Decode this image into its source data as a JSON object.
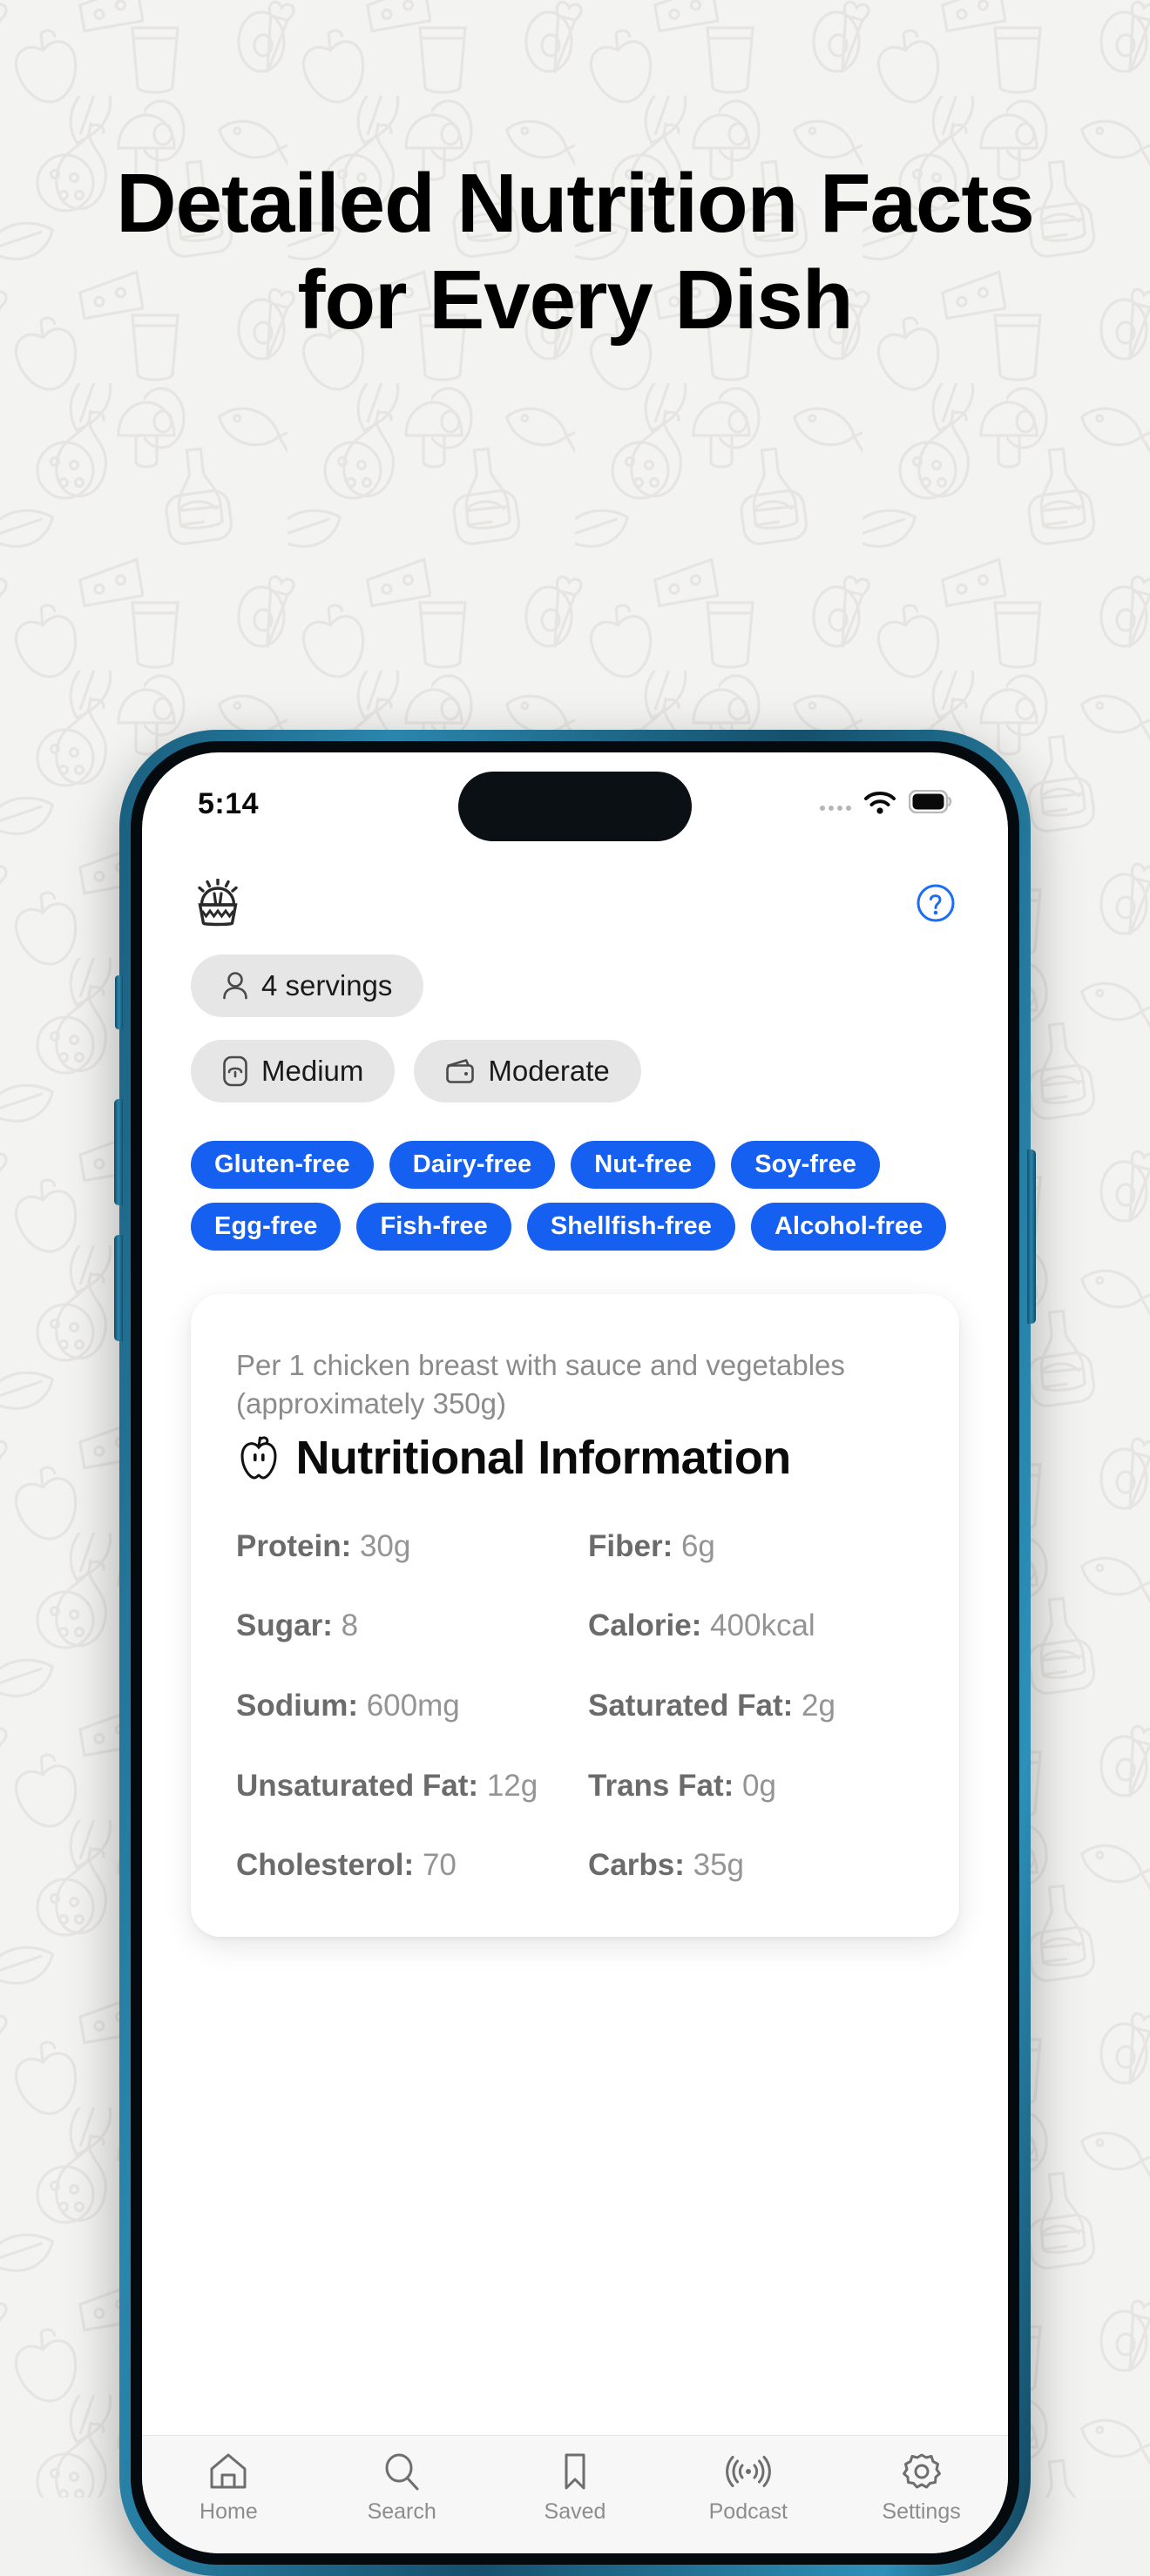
{
  "headline": "Detailed Nutrition Facts for Every Dish",
  "theme": {
    "accent_blue": "#1560f0",
    "help_blue": "#1a6ef5",
    "phone_frame": "#1a6387",
    "chip_bg": "#e6e6e6",
    "page_bg": "#f3f3f1"
  },
  "status_bar": {
    "time": "5:14",
    "signal_icon": "signal-dots-icon",
    "wifi_icon": "wifi-icon",
    "battery_icon": "battery-icon"
  },
  "app_header": {
    "logo_icon": "basket-logo-icon",
    "help_icon": "help-circle-icon"
  },
  "chips": [
    {
      "label": "4 servings",
      "icon": "person-icon"
    },
    {
      "label": "Medium",
      "icon": "gauge-icon"
    },
    {
      "label": "Moderate",
      "icon": "wallet-icon"
    }
  ],
  "diet_tags": [
    "Gluten-free",
    "Dairy-free",
    "Nut-free",
    "Soy-free",
    "Egg-free",
    "Fish-free",
    "Shellfish-free",
    "Alcohol-free"
  ],
  "nutrition_card": {
    "serving_note": "Per 1 chicken breast with sauce and vegetables (approximately 350g)",
    "title": "Nutritional Information",
    "title_icon": "apple-icon",
    "items": [
      {
        "label": "Protein:",
        "value": "30g"
      },
      {
        "label": "Fiber:",
        "value": "6g"
      },
      {
        "label": "Sugar:",
        "value": "8"
      },
      {
        "label": "Calorie:",
        "value": "400kcal"
      },
      {
        "label": "Sodium:",
        "value": "600mg"
      },
      {
        "label": "Saturated Fat:",
        "value": "2g"
      },
      {
        "label": "Unsaturated Fat:",
        "value": "12g"
      },
      {
        "label": "Trans Fat:",
        "value": "0g"
      },
      {
        "label": "Cholesterol:",
        "value": "70"
      },
      {
        "label": "Carbs:",
        "value": "35g"
      }
    ]
  },
  "tabbar": [
    {
      "label": "Home",
      "icon": "home-icon"
    },
    {
      "label": "Search",
      "icon": "search-icon"
    },
    {
      "label": "Saved",
      "icon": "bookmark-icon"
    },
    {
      "label": "Podcast",
      "icon": "broadcast-icon"
    },
    {
      "label": "Settings",
      "icon": "gear-icon"
    }
  ]
}
